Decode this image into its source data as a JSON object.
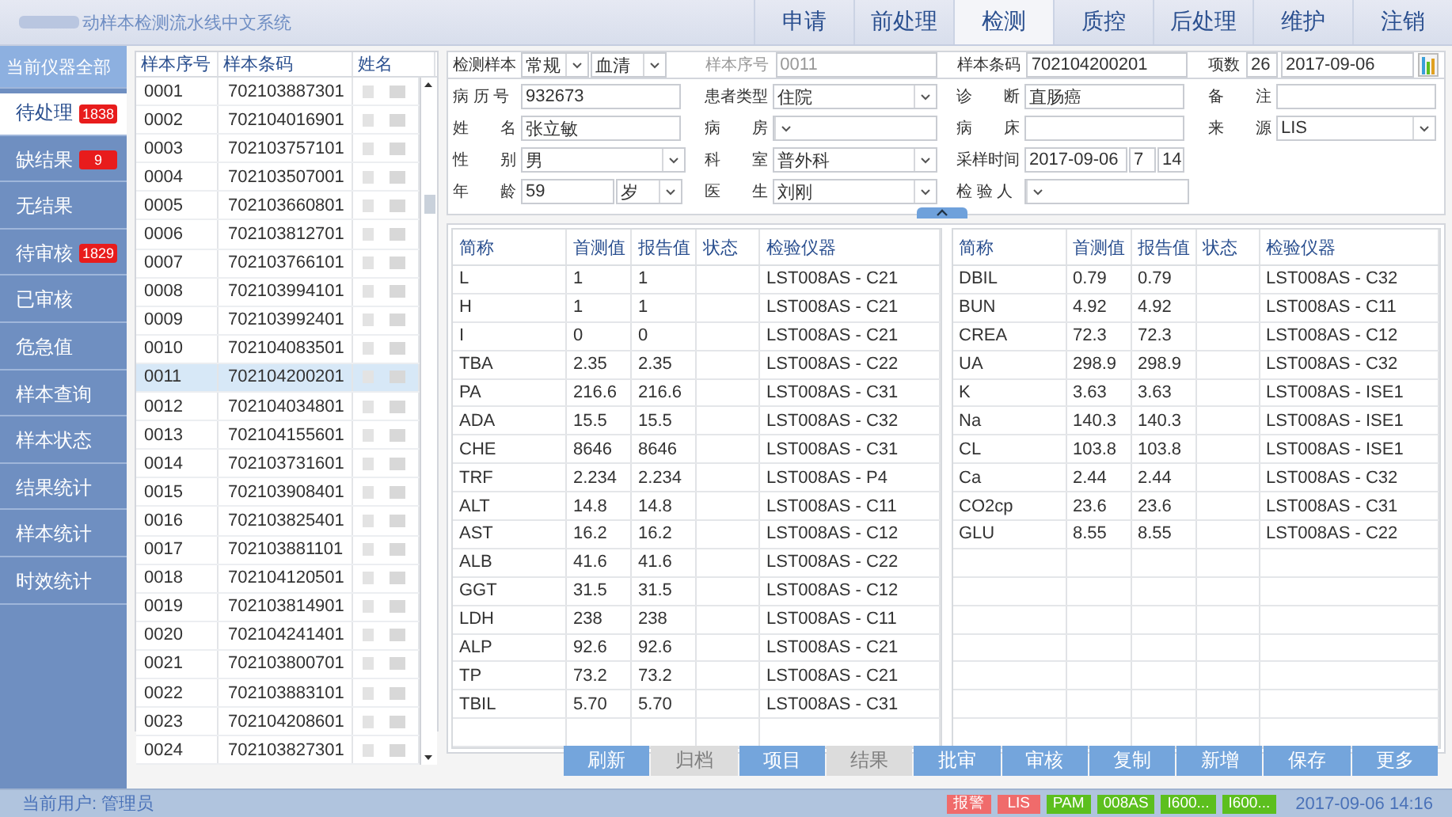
{
  "window": {
    "title": "动样本检测流水线中文系统"
  },
  "tabs": [
    {
      "label": "申请",
      "selected": false
    },
    {
      "label": "前处理",
      "selected": false
    },
    {
      "label": "检测",
      "selected": true
    },
    {
      "label": "质控",
      "selected": false
    },
    {
      "label": "后处理",
      "selected": false
    },
    {
      "label": "维护",
      "selected": false
    },
    {
      "label": "注销",
      "selected": false
    }
  ],
  "sidebar": {
    "items": [
      {
        "label": "当前仪器全部",
        "kind": "header",
        "selected": false
      },
      {
        "label": "待处理",
        "badge": "1838",
        "kind": "item",
        "selected": true
      },
      {
        "label": "缺结果",
        "badge": "9",
        "kind": "item",
        "selected": false
      },
      {
        "label": "无结果",
        "kind": "item",
        "selected": false
      },
      {
        "label": "待审核",
        "badge": "1829",
        "kind": "item",
        "selected": false
      },
      {
        "label": "已审核",
        "kind": "item",
        "selected": false
      },
      {
        "label": "危急值",
        "kind": "item",
        "selected": false
      },
      {
        "label": "样本查询",
        "kind": "item",
        "selected": false
      },
      {
        "label": "样本状态",
        "kind": "item",
        "selected": false
      },
      {
        "label": "结果统计",
        "kind": "item",
        "selected": false
      },
      {
        "label": "样本统计",
        "kind": "item",
        "selected": false
      },
      {
        "label": "时效统计",
        "kind": "item",
        "selected": false
      }
    ]
  },
  "sample_list": {
    "columns": [
      "样本序号",
      "样本条码",
      "姓名"
    ],
    "rows": [
      {
        "seq": "0001",
        "barcode": "702103887301",
        "selected": false
      },
      {
        "seq": "0002",
        "barcode": "702104016901",
        "selected": false
      },
      {
        "seq": "0003",
        "barcode": "702103757101",
        "selected": false
      },
      {
        "seq": "0004",
        "barcode": "702103507001",
        "selected": false
      },
      {
        "seq": "0005",
        "barcode": "702103660801",
        "selected": false
      },
      {
        "seq": "0006",
        "barcode": "702103812701",
        "selected": false
      },
      {
        "seq": "0007",
        "barcode": "702103766101",
        "selected": false
      },
      {
        "seq": "0008",
        "barcode": "702103994101",
        "selected": false
      },
      {
        "seq": "0009",
        "barcode": "702103992401",
        "selected": false
      },
      {
        "seq": "0010",
        "barcode": "702104083501",
        "selected": false
      },
      {
        "seq": "0011",
        "barcode": "702104200201",
        "selected": true
      },
      {
        "seq": "0012",
        "barcode": "702104034801",
        "selected": false
      },
      {
        "seq": "0013",
        "barcode": "702104155601",
        "selected": false
      },
      {
        "seq": "0014",
        "barcode": "702103731601",
        "selected": false
      },
      {
        "seq": "0015",
        "barcode": "702103908401",
        "selected": false
      },
      {
        "seq": "0016",
        "barcode": "702103825401",
        "selected": false
      },
      {
        "seq": "0017",
        "barcode": "702103881101",
        "selected": false
      },
      {
        "seq": "0018",
        "barcode": "702104120501",
        "selected": false
      },
      {
        "seq": "0019",
        "barcode": "702103814901",
        "selected": false
      },
      {
        "seq": "0020",
        "barcode": "702104241401",
        "selected": false
      },
      {
        "seq": "0021",
        "barcode": "702103800701",
        "selected": false
      },
      {
        "seq": "0022",
        "barcode": "702103883101",
        "selected": false
      },
      {
        "seq": "0023",
        "barcode": "702104208601",
        "selected": false
      },
      {
        "seq": "0024",
        "barcode": "702103827301",
        "selected": false
      }
    ]
  },
  "sample_header": [
    {
      "label": "检测样本",
      "kind": "select2",
      "values": [
        "常规",
        "血清"
      ]
    },
    {
      "label": "样本序号",
      "kind": "text",
      "value": "0011",
      "disabled": true
    },
    {
      "label": "样本条码",
      "kind": "text",
      "value": "702104200201",
      "disabled": false
    },
    {
      "label": "项数",
      "kind": "count",
      "value": "26",
      "date": "2017-09-06"
    }
  ],
  "patient_form": [
    [
      {
        "label": "病 历 号",
        "kind": "text",
        "value": "932673"
      },
      {
        "label": "患者类型",
        "kind": "select",
        "value": "住院"
      },
      {
        "label": "诊　　断",
        "kind": "text",
        "value": "直肠癌"
      },
      {
        "label": "备　　注",
        "kind": "text"
      }
    ],
    [
      {
        "label": "姓　　名",
        "kind": "text",
        "value": "张立敏"
      },
      {
        "label": "病　　房",
        "kind": "select"
      },
      {
        "label": "病　　床",
        "kind": "text"
      },
      {
        "label": "来　　源",
        "kind": "select",
        "value": "LIS"
      }
    ],
    [
      {
        "label": "性　　别",
        "kind": "select",
        "value": "男"
      },
      {
        "label": "科　　室",
        "kind": "select",
        "value": "普外科"
      },
      {
        "label": "采样时间",
        "kind": "time",
        "value": "2017-09-06",
        "hour": "7",
        "minute": "14"
      }
    ],
    [
      {
        "label": "年　　龄",
        "kind": "age",
        "value": "59",
        "unit": "岁"
      },
      {
        "label": "医　　生",
        "kind": "select",
        "value": "刘刚"
      },
      {
        "label": "检 验 人",
        "kind": "select"
      }
    ]
  ],
  "results": {
    "left_columns": [
      "简称",
      "首测值",
      "报告值",
      "状态",
      "检验仪器"
    ],
    "right_columns": [
      "简称",
      "首测值",
      "报告值",
      "状态",
      "检验仪器"
    ],
    "left_rows": [
      [
        "L",
        "1",
        "1",
        "LST008AS - C21"
      ],
      [
        "H",
        "1",
        "1",
        "LST008AS - C21"
      ],
      [
        "I",
        "0",
        "0",
        "LST008AS - C21"
      ],
      [
        "TBA",
        "2.35",
        "2.35",
        "LST008AS - C22"
      ],
      [
        "PA",
        "216.6",
        "216.6",
        "LST008AS - C31"
      ],
      [
        "ADA",
        "15.5",
        "15.5",
        "LST008AS - C32"
      ],
      [
        "CHE",
        "8646",
        "8646",
        "LST008AS - C31"
      ],
      [
        "TRF",
        "2.234",
        "2.234",
        "LST008AS - P4"
      ],
      [
        "ALT",
        "14.8",
        "14.8",
        "LST008AS - C11"
      ],
      [
        "AST",
        "16.2",
        "16.2",
        "LST008AS - C12"
      ],
      [
        "ALB",
        "41.6",
        "41.6",
        "LST008AS - C22"
      ],
      [
        "GGT",
        "31.5",
        "31.5",
        "LST008AS - C12"
      ],
      [
        "LDH",
        "238",
        "238",
        "LST008AS - C11"
      ],
      [
        "ALP",
        "92.6",
        "92.6",
        "LST008AS - C21"
      ],
      [
        "TP",
        "73.2",
        "73.2",
        "LST008AS - C21"
      ],
      [
        "TBIL",
        "5.70",
        "5.70",
        "LST008AS - C31"
      ]
    ],
    "right_rows": [
      [
        "DBIL",
        "0.79",
        "0.79",
        "LST008AS - C32"
      ],
      [
        "BUN",
        "4.92",
        "4.92",
        "LST008AS - C11"
      ],
      [
        "CREA",
        "72.3",
        "72.3",
        "LST008AS - C12"
      ],
      [
        "UA",
        "298.9",
        "298.9",
        "LST008AS - C32"
      ],
      [
        "K",
        "3.63",
        "3.63",
        "LST008AS - ISE1"
      ],
      [
        "Na",
        "140.3",
        "140.3",
        "LST008AS - ISE1"
      ],
      [
        "CL",
        "103.8",
        "103.8",
        "LST008AS - ISE1"
      ],
      [
        "Ca",
        "2.44",
        "2.44",
        "LST008AS - C32"
      ],
      [
        "CO2cp",
        "23.6",
        "23.6",
        "LST008AS - C31"
      ],
      [
        "GLU",
        "8.55",
        "8.55",
        "LST008AS - C22"
      ]
    ]
  },
  "buttons": [
    {
      "label": "刷新",
      "disabled": false
    },
    {
      "label": "归档",
      "disabled": true
    },
    {
      "label": "项目",
      "disabled": false
    },
    {
      "label": "结果",
      "disabled": true
    },
    {
      "label": "批审",
      "disabled": false
    },
    {
      "label": "审核",
      "disabled": false
    },
    {
      "label": "复制",
      "disabled": false
    },
    {
      "label": "新增",
      "disabled": false
    },
    {
      "label": "保存",
      "disabled": false
    },
    {
      "label": "更多",
      "disabled": false
    }
  ],
  "status_bar": {
    "user": "当前用户: 管理员",
    "indicators": [
      {
        "label": "报警",
        "color": "#f06b6b"
      },
      {
        "label": "LIS",
        "color": "#f06b6b"
      },
      {
        "label": "PAM",
        "color": "#5cbf1e"
      },
      {
        "label": "008AS",
        "color": "#5cbf1e"
      },
      {
        "label": "I600...",
        "color": "#5cbf1e"
      },
      {
        "label": "I600...",
        "color": "#5cbf1e"
      }
    ],
    "datetime": "2017-09-06 14:16"
  }
}
